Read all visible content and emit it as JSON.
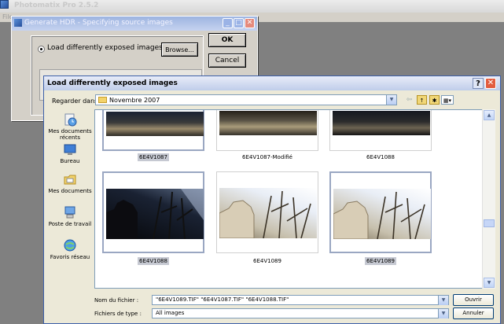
{
  "app": {
    "title": "Photomatix Pro 2.5.2",
    "menu_first": "File"
  },
  "generate_dialog": {
    "title": "Generate HDR - Specifying source images",
    "radio_label": "Load differently exposed images",
    "browse_label": "Browse...",
    "ok_label": "OK",
    "cancel_label": "Cancel"
  },
  "load_dialog": {
    "title": "Load differently exposed images",
    "help": "?",
    "close": "✕",
    "look_in_label": "Regarder dans :",
    "look_in_value": "Novembre 2007",
    "places": [
      {
        "label": "Mes documents récents",
        "icon": "recent-documents-icon"
      },
      {
        "label": "Bureau",
        "icon": "desktop-icon"
      },
      {
        "label": "Mes documents",
        "icon": "my-documents-icon"
      },
      {
        "label": "Poste de travail",
        "icon": "my-computer-icon"
      },
      {
        "label": "Favoris réseau",
        "icon": "network-places-icon"
      }
    ],
    "files_top": [
      {
        "name": "6E4V1087",
        "selected": true
      },
      {
        "name": "6E4V1087-Modifié",
        "selected": false
      },
      {
        "name": "6E4V1088",
        "selected": false
      }
    ],
    "files_main": [
      {
        "name": "6E4V1088",
        "selected": true
      },
      {
        "name": "6E4V1089",
        "selected": false
      },
      {
        "name": "6E4V1089",
        "selected": true
      }
    ],
    "filename_label": "Nom du fichier :",
    "filename_value": "\"6E4V1089.TIF\" \"6E4V1087.TIF\" \"6E4V1088.TIF\"",
    "filetype_label": "Fichiers de type :",
    "filetype_value": "All images",
    "open_label": "Ouvrir",
    "cancel_label": "Annuler"
  }
}
